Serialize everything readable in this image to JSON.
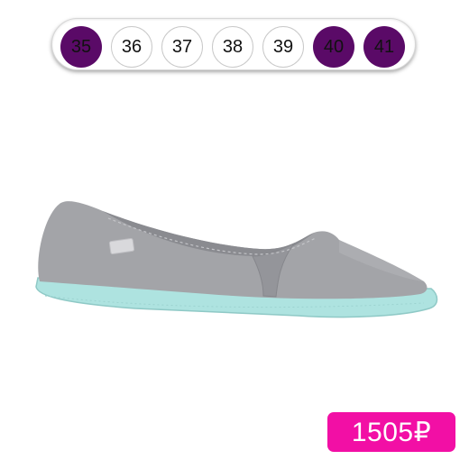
{
  "sizes": [
    {
      "label": "35",
      "available": true
    },
    {
      "label": "36",
      "available": false
    },
    {
      "label": "37",
      "available": false
    },
    {
      "label": "38",
      "available": false
    },
    {
      "label": "39",
      "available": false
    },
    {
      "label": "40",
      "available": true
    },
    {
      "label": "41",
      "available": true
    }
  ],
  "product": {
    "image": "grey-canvas-slip-on-shoe",
    "price": "1505₽"
  },
  "colors": {
    "available_size": "#5a0a67",
    "price_badge": "#f20fa5",
    "shoe_upper": "#a3a4a8",
    "shoe_sole": "#aee3e0"
  }
}
